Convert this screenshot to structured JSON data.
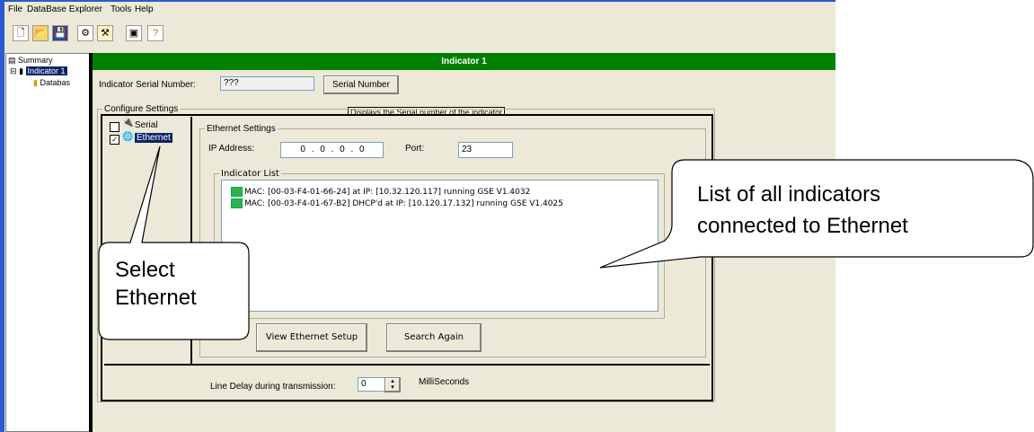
{
  "menu": [
    "File",
    "DataBase Explorer",
    "Tools",
    "Help"
  ],
  "toolbar_icons": [
    "new-file-icon",
    "open-folder-icon",
    "save-icon",
    "satellite-icon",
    "tools-icon",
    "monitor-icon",
    "help-icon"
  ],
  "tree": {
    "summary": "Summary",
    "indicator": "Indicator 1",
    "database": "Databas"
  },
  "panel": {
    "title": "Indicator 1",
    "serial_label": "Indicator Serial Number:",
    "serial_value": "???",
    "serial_button": "Serial Number",
    "tooltip": "Displays the Serial number of the indicator",
    "configure_legend": "Configure Settings",
    "types": [
      "Serial",
      "Ethernet"
    ],
    "ethernet_legend": "Ethernet Settings",
    "ip_label": "IP Address:",
    "ip_value": "0 . 0 . 0 . 0",
    "port_label": "Port:",
    "port_value": "23",
    "list_legend": "Indicator List",
    "indicators": [
      "MAC: [00-03-F4-01-66-24] at IP: [10.32.120.117] running GSE V1.4032",
      "MAC: [00-03-F4-01-67-B2] DHCP'd at IP: [10.120.17.132] running GSE V1.4025"
    ],
    "view_button": "View Ethernet Setup",
    "search_button": "Search Again",
    "line_delay_label": "Line Delay during transmission:",
    "line_delay_value": "0",
    "line_delay_unit": "MilliSeconds"
  },
  "callouts": {
    "select_line1": "Select",
    "select_line2": "Ethernet",
    "list_line1": "List of all indicators",
    "list_line2": "connected to Ethernet"
  },
  "colors": {
    "title_bar": "#008000",
    "window_border": "#2a5bd0",
    "selection": "#0a246a"
  }
}
